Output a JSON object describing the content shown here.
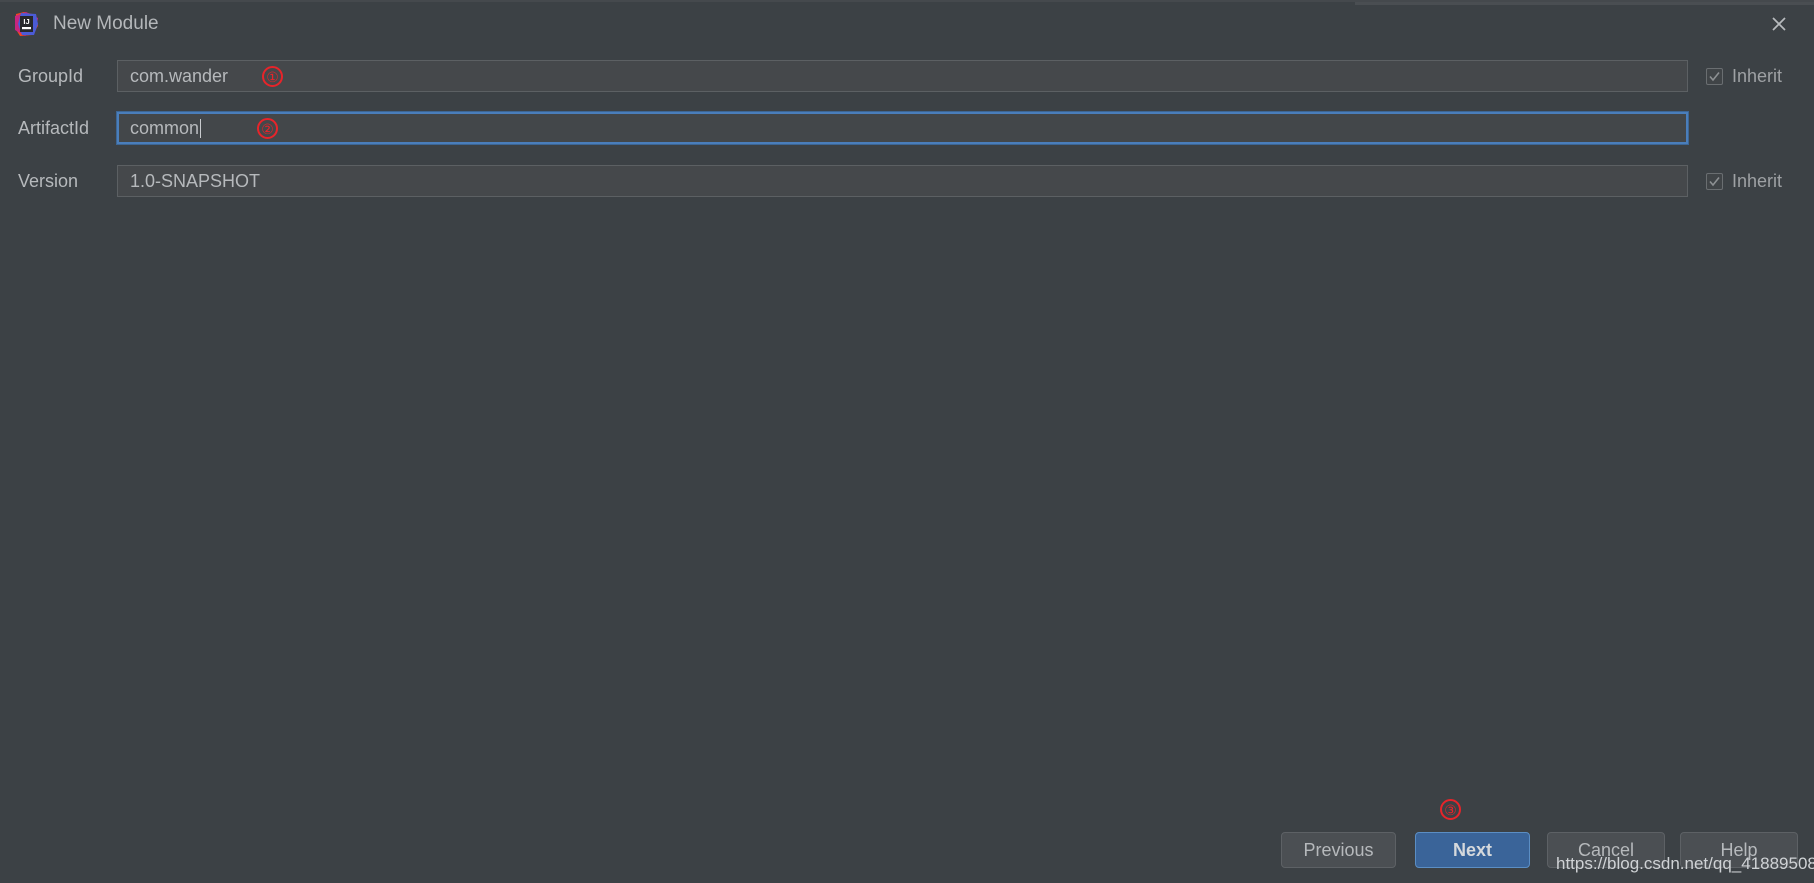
{
  "window": {
    "title": "New Module",
    "app_icon": "intellij-idea-icon",
    "close_icon": "close-icon",
    "background_color": "#3c4145"
  },
  "form": {
    "fields": [
      {
        "label": "GroupId",
        "value": "com.wander",
        "focused": false,
        "marker": "①",
        "inherit": {
          "label": "Inherit",
          "checked": true,
          "enabled": false
        }
      },
      {
        "label": "ArtifactId",
        "value": "common",
        "focused": true,
        "marker": "②",
        "inherit": null
      },
      {
        "label": "Version",
        "value": "1.0-SNAPSHOT",
        "focused": false,
        "marker": null,
        "inherit": {
          "label": "Inherit",
          "checked": true,
          "enabled": false
        }
      }
    ]
  },
  "buttons": {
    "previous": "Previous",
    "next": "Next",
    "cancel": "Cancel",
    "help": "Help",
    "next_marker": "③",
    "default_button_color": "#3a6499"
  },
  "watermark": {
    "text": "https://blog.csdn.net/qq_41889508"
  },
  "colors": {
    "accent": "#4a7ebb",
    "marker_red": "#e8242a",
    "text": "#b6b9bc"
  }
}
